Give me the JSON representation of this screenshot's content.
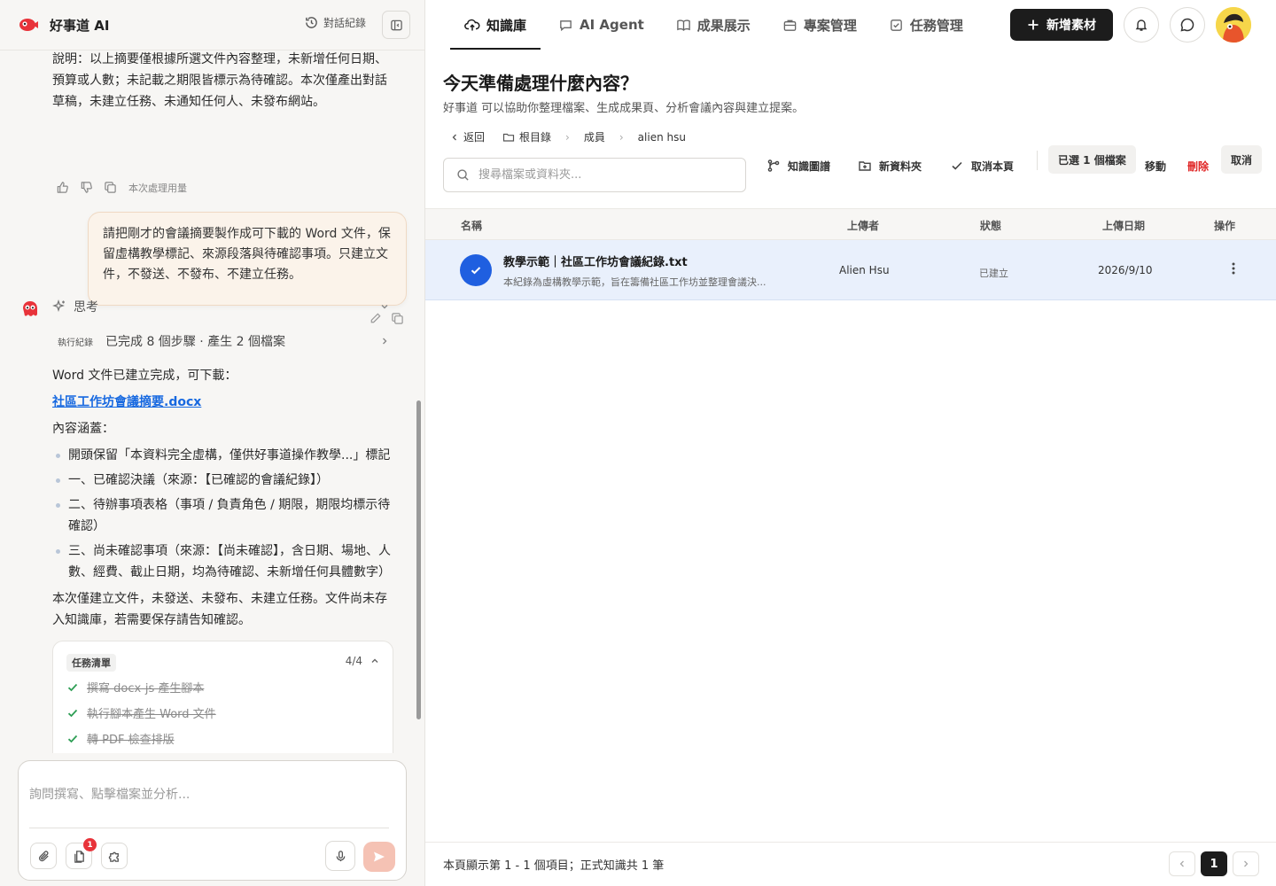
{
  "app": {
    "name": "好事道 AI",
    "history_label": "對話紀錄"
  },
  "chat": {
    "assistant_note": "說明：以上摘要僅根據所選文件內容整理，未新增任何日期、預算或人數；未記載之期限皆標示為待確認。本次僅產出對話草稿，未建立任務、未通知任何人、未發布網站。",
    "usage_label": "本次處理用量",
    "user_message": "請把剛才的會議摘要製作成可下載的 Word 文件，保留虛構教學標記、來源段落與待確認事項。只建立文件，不發送、不發布、不建立任務。",
    "think_label": "思考",
    "exec_tag": "執行紀錄",
    "exec_text": "已完成 8 個步驟 · 產生 2 個檔案",
    "doc_ready": "Word 文件已建立完成，可下載：",
    "doc_link": "社區工作坊會議摘要.docx",
    "contents_label": "內容涵蓋：",
    "bullets": [
      "開頭保留「本資料完全虛構，僅供好事道操作教學...」標記",
      "一、已確認決議（來源：【已確認的會議紀錄】）",
      "二、待辦事項表格（事項 / 負責角色 / 期限，期限均標示待確認）",
      "三、尚未確認事項（來源：【尚未確認】，含日期、場地、人數、經費、截止日期，均為待確認、未新增任何具體數字）"
    ],
    "closing": "本次僅建立文件，未發送、未發布、未建立任務。文件尚未存入知識庫，若需要保存請告知確認。",
    "task_card": {
      "tag": "任務清單",
      "count": "4/4",
      "items": [
        "撰寫 docx-js 產生腳本",
        "執行腳本產生 Word 文件",
        "轉 PDF 檢查排版"
      ]
    },
    "input_placeholder": "詢問撰寫、點擊檔案並分析...",
    "attachment_badge": "1"
  },
  "nav": {
    "tabs": [
      "知識庫",
      "AI Agent",
      "成果展示",
      "專案管理",
      "任務管理"
    ],
    "new_button": "新增素材"
  },
  "page": {
    "title": "今天準備處理什麼內容？",
    "subtitle": "好事道 可以協助你整理檔案、生成成果頁、分析會議內容與建立提案。"
  },
  "breadcrumb": {
    "back": "返回",
    "root": "根目錄",
    "members": "成員",
    "current": "alien hsu"
  },
  "search": {
    "placeholder": "搜尋檔案或資料夾..."
  },
  "actions": {
    "graph": "知識圖譜",
    "new_folder": "新資料夾",
    "deselect_page": "取消本頁",
    "selected": "已選 1 個檔案",
    "move": "移動",
    "delete": "刪除",
    "cancel": "取消"
  },
  "table": {
    "headers": [
      "名稱",
      "上傳者",
      "狀態",
      "上傳日期",
      "操作"
    ],
    "rows": [
      {
        "name": "教學示範｜社區工作坊會議紀錄.txt",
        "desc": "本紀錄為虛構教學示範，旨在籌備社區工作坊並整理會議決...",
        "uploader": "Alien Hsu",
        "status": "已建立",
        "date": "2026/9/10"
      }
    ]
  },
  "footer": {
    "summary": "本頁顯示第 1 - 1 個項目；正式知識共 1 筆",
    "page": "1"
  },
  "colors": {
    "accent_blue": "#1f5fe0",
    "danger": "#e02424",
    "primary_dark": "#1c1c1c",
    "bubble": "#fbf3ea"
  }
}
